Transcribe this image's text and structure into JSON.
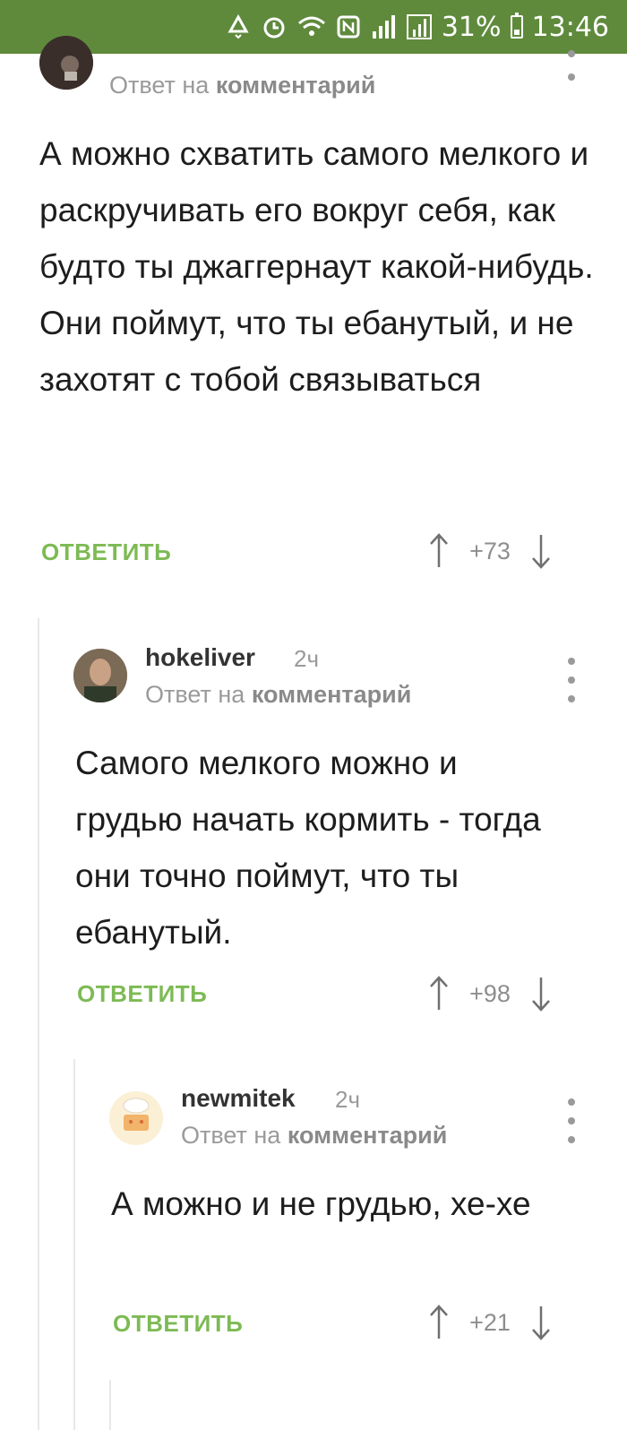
{
  "status_bar": {
    "battery_percent": "31%",
    "time": "13:46",
    "icons": [
      "recycle-icon",
      "alarm-icon",
      "wifi-icon",
      "nfc-icon",
      "signal-icon",
      "signal-2-icon"
    ]
  },
  "colors": {
    "status_bar_bg": "#5f8a3c",
    "reply_green": "#7dba54",
    "meta_gray": "#9a9a9a"
  },
  "comments": [
    {
      "author": "",
      "time": "",
      "reply_prefix": "Ответ на",
      "reply_target": "комментарий",
      "text": "А можно схватить самого мелкого и раскручивать его вокруг себя, как будто ты джаггернаут какой-нибудь. Они поймут, что ты ебанутый, и не захотят с тобой связываться",
      "reply_label": "ОТВЕТИТЬ",
      "votes": "+73"
    },
    {
      "author": "hokeliver",
      "time": "2ч",
      "reply_prefix": "Ответ на",
      "reply_target": "комментарий",
      "text": "Самого мелкого можно и грудью начать кормить - тогда они точно поймут, что ты ебанутый.",
      "reply_label": "ОТВЕТИТЬ",
      "votes": "+98"
    },
    {
      "author": "newmitek",
      "time": "2ч",
      "reply_prefix": "Ответ на",
      "reply_target": "комментарий",
      "text": "А можно и не грудью, хе-хе",
      "reply_label": "ОТВЕТИТЬ",
      "votes": "+21"
    }
  ]
}
